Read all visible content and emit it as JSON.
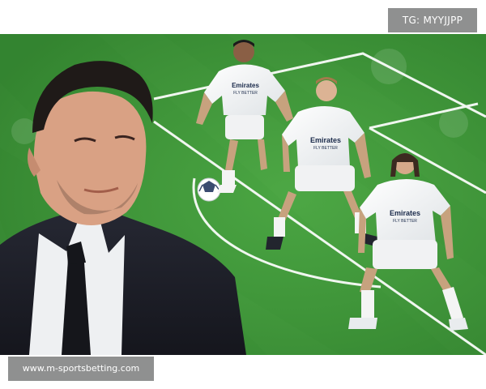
{
  "watermark": {
    "tag": "TG: MYYJJPP",
    "site": "www.m-sportsbetting.com"
  },
  "players": [
    {
      "sponsor_main": "Emirates",
      "sponsor_sub": "FLY BETTER"
    },
    {
      "sponsor_main": "Emirates",
      "sponsor_sub": "FLY BETTER"
    },
    {
      "sponsor_main": "Emirates",
      "sponsor_sub": "FLY BETTER"
    }
  ],
  "colors": {
    "pitch_green": "#3f9a3a",
    "pitch_stripe": "#4aa444",
    "line_white": "#ffffff",
    "suit": "#1c1e28",
    "badge_grey": "#8f9090"
  }
}
